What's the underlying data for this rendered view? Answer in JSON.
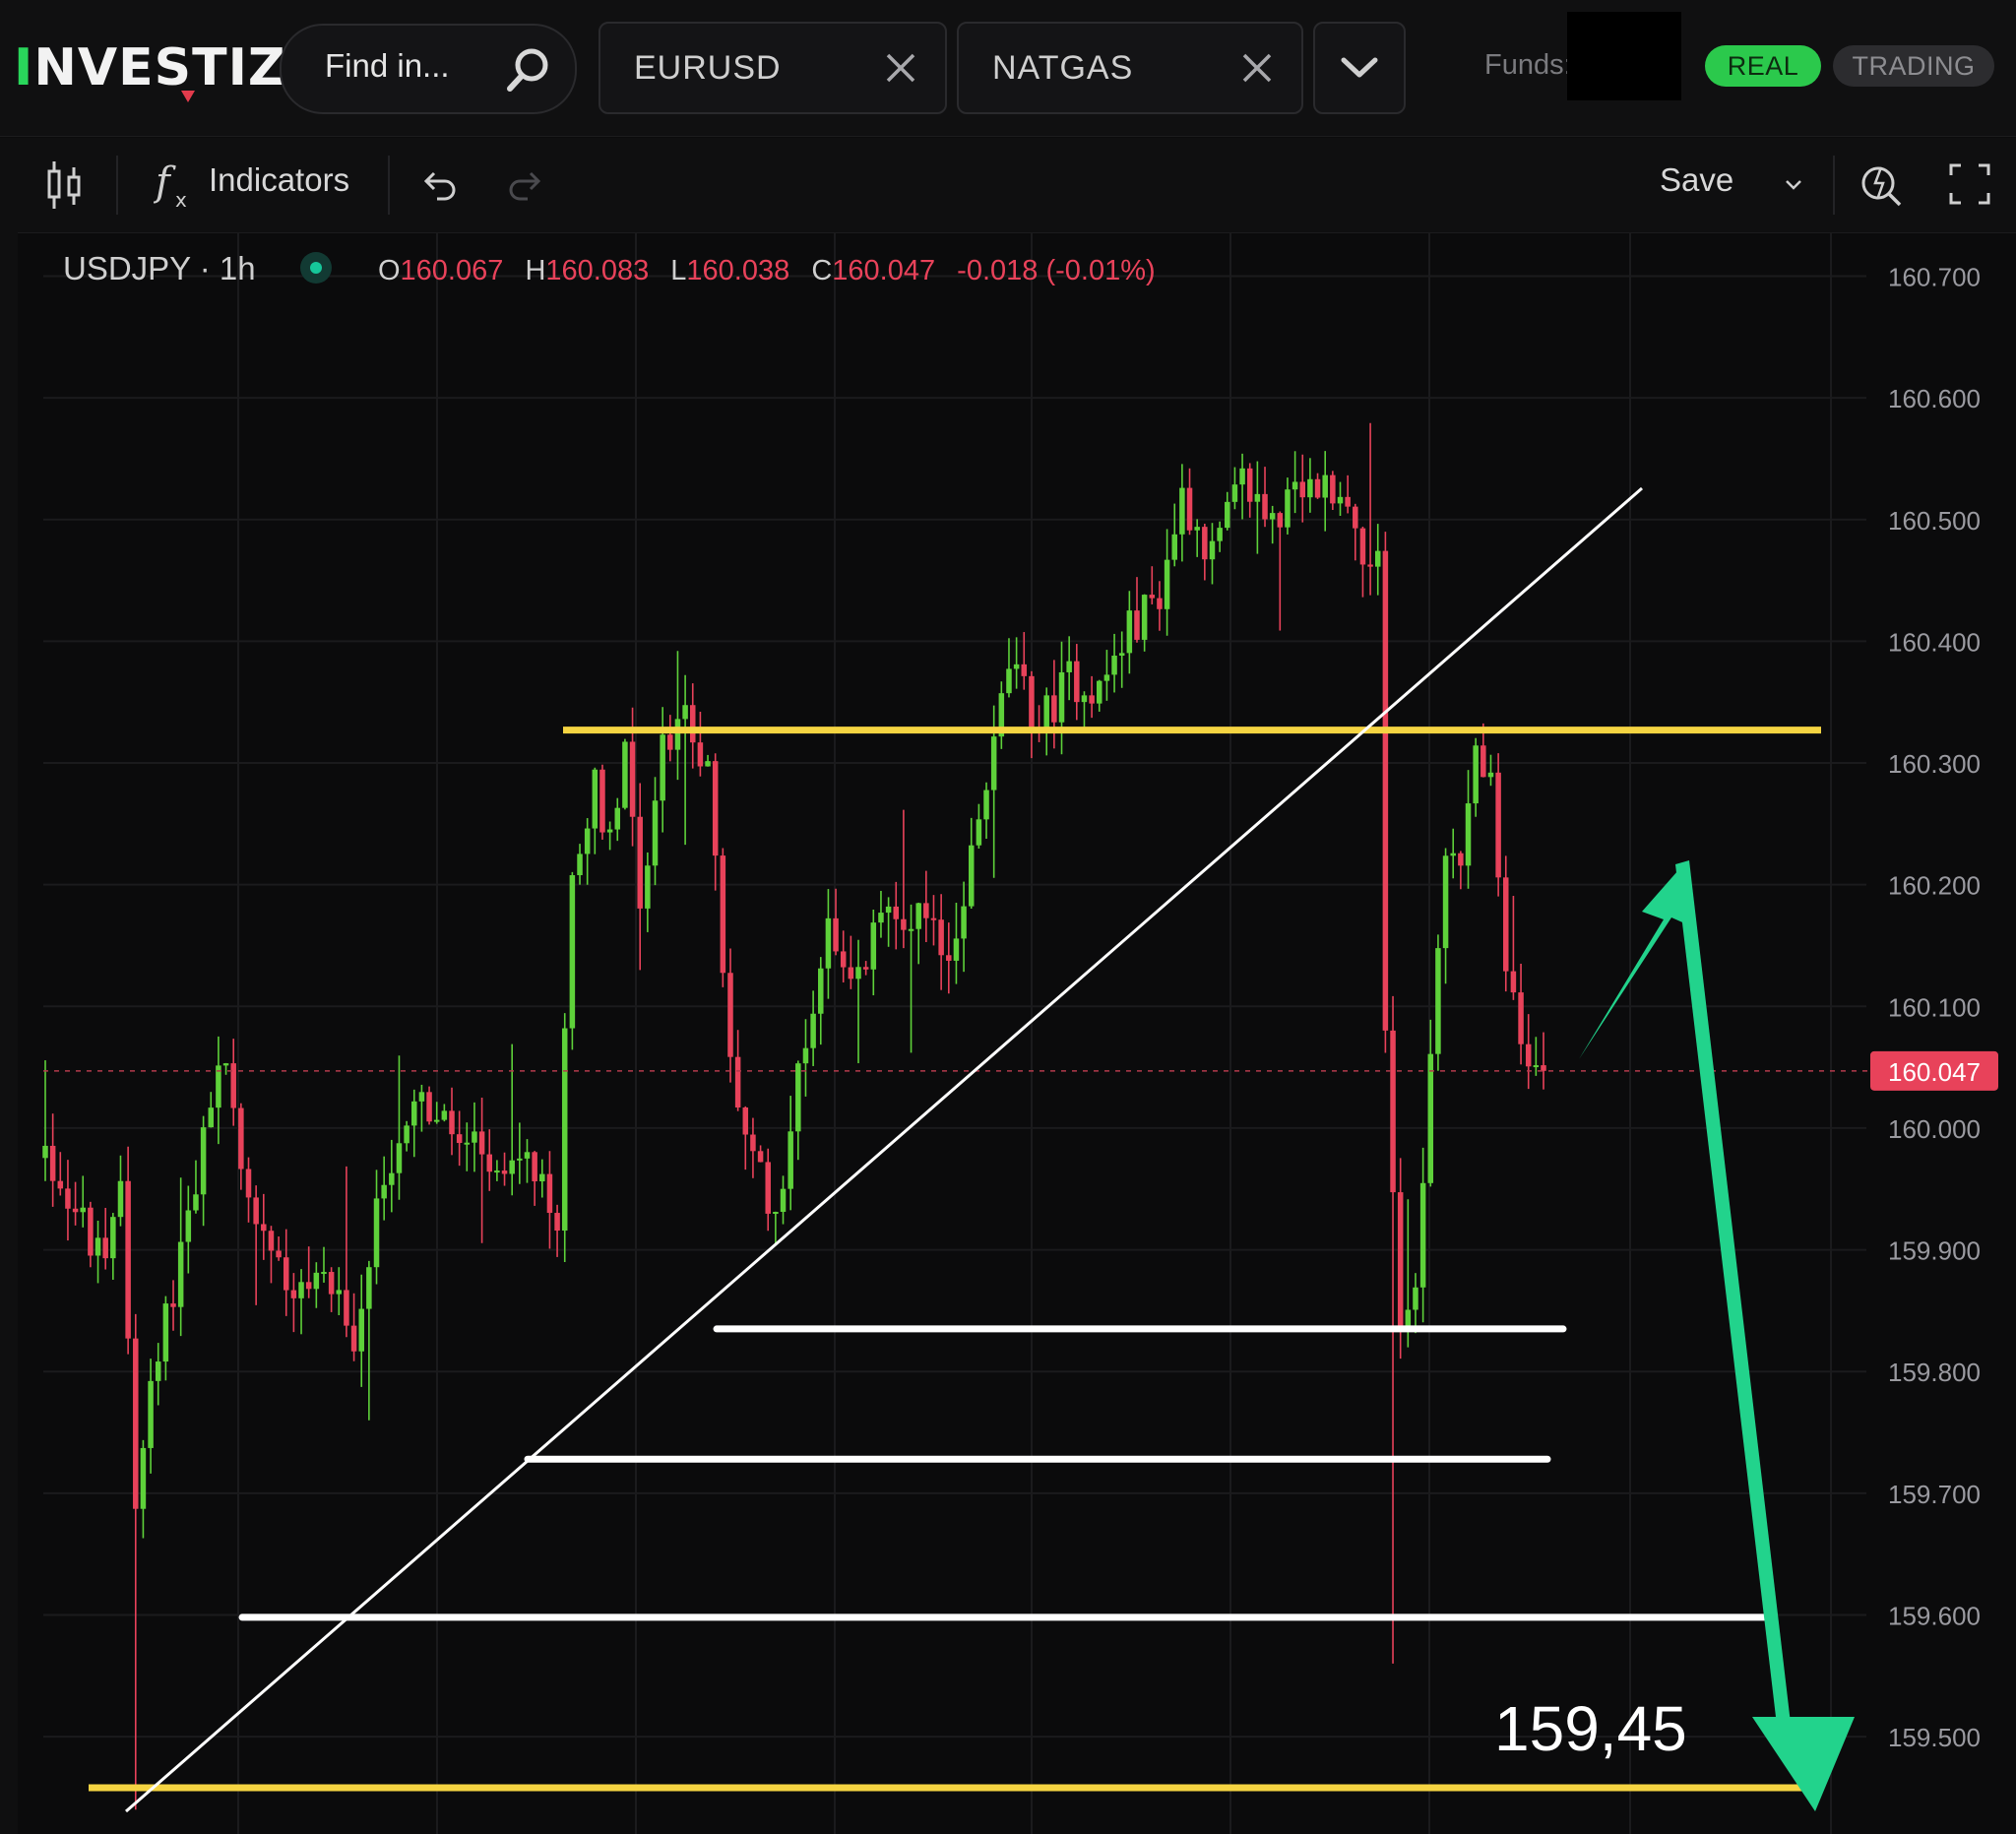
{
  "header": {
    "logo_text": "INVESTIZO",
    "search_placeholder": "Find in...",
    "tabs": [
      {
        "label": "EURUSD"
      },
      {
        "label": "NATGAS"
      }
    ],
    "funds_label": "Funds:",
    "mode_real": "REAL",
    "mode_trading": "TRADING"
  },
  "toolbar": {
    "indicators_label": "Indicators",
    "save_label": "Save"
  },
  "legend": {
    "symbol": "USDJPY · 1h",
    "open_key": "O",
    "open": "160.067",
    "high_key": "H",
    "high": "160.083",
    "low_key": "L",
    "low": "160.038",
    "close_key": "C",
    "close": "160.047",
    "change": "-0.018 (-0.01%)"
  },
  "colors": {
    "up": "#5ed13a",
    "down": "#e8425a",
    "accent_green": "#2bc94c",
    "annotation_yellow": "#f5d442",
    "annotation_arrow": "#22d38c"
  },
  "chart_data": {
    "type": "candlestick",
    "ylim": [
      159.42,
      160.736
    ],
    "yticks": [
      "160.700",
      "160.600",
      "160.500",
      "160.400",
      "160.300",
      "160.200",
      "160.100",
      "160.000",
      "159.900",
      "159.800",
      "159.700",
      "159.600",
      "159.500"
    ],
    "current_price": "160.047",
    "candles_count": 200,
    "levels": {
      "resistance_yellow": 160.327,
      "support_yellow": 159.458,
      "white_1": 159.835,
      "white_2": 159.728,
      "white_3": 159.598
    },
    "target_label": "159,45",
    "keypoints": [
      [
        0,
        159.98
      ],
      [
        5,
        159.92
      ],
      [
        8,
        159.88
      ],
      [
        10,
        159.96
      ],
      [
        12,
        159.7
      ],
      [
        14,
        159.78
      ],
      [
        18,
        159.9
      ],
      [
        22,
        160.02
      ],
      [
        24,
        160.06
      ],
      [
        26,
        159.96
      ],
      [
        30,
        159.9
      ],
      [
        34,
        159.86
      ],
      [
        38,
        159.88
      ],
      [
        41,
        159.82
      ],
      [
        45,
        159.96
      ],
      [
        49,
        160.03
      ],
      [
        53,
        160.0
      ],
      [
        57,
        159.98
      ],
      [
        61,
        159.95
      ],
      [
        64,
        159.97
      ],
      [
        68,
        159.92
      ],
      [
        70,
        160.22
      ],
      [
        73,
        160.28
      ],
      [
        75,
        160.24
      ],
      [
        77,
        160.32
      ],
      [
        79,
        160.19
      ],
      [
        82,
        160.31
      ],
      [
        85,
        160.35
      ],
      [
        88,
        160.29
      ],
      [
        91,
        160.05
      ],
      [
        94,
        159.97
      ],
      [
        97,
        159.93
      ],
      [
        100,
        160.04
      ],
      [
        104,
        160.17
      ],
      [
        108,
        160.12
      ],
      [
        112,
        160.19
      ],
      [
        116,
        160.17
      ],
      [
        120,
        160.14
      ],
      [
        124,
        160.25
      ],
      [
        128,
        160.38
      ],
      [
        132,
        160.33
      ],
      [
        136,
        160.37
      ],
      [
        140,
        160.36
      ],
      [
        144,
        160.41
      ],
      [
        148,
        160.44
      ],
      [
        151,
        160.52
      ],
      [
        155,
        160.47
      ],
      [
        159,
        160.53
      ],
      [
        163,
        160.5
      ],
      [
        167,
        160.52
      ],
      [
        171,
        160.53
      ],
      [
        175,
        160.48
      ],
      [
        177,
        160.46
      ],
      [
        178,
        160.08
      ],
      [
        180,
        159.83
      ],
      [
        182,
        159.88
      ],
      [
        184,
        160.05
      ],
      [
        186,
        160.24
      ],
      [
        188,
        160.21
      ],
      [
        190,
        160.33
      ],
      [
        192,
        160.28
      ],
      [
        194,
        160.12
      ],
      [
        197,
        160.05
      ],
      [
        199,
        160.047
      ]
    ]
  }
}
